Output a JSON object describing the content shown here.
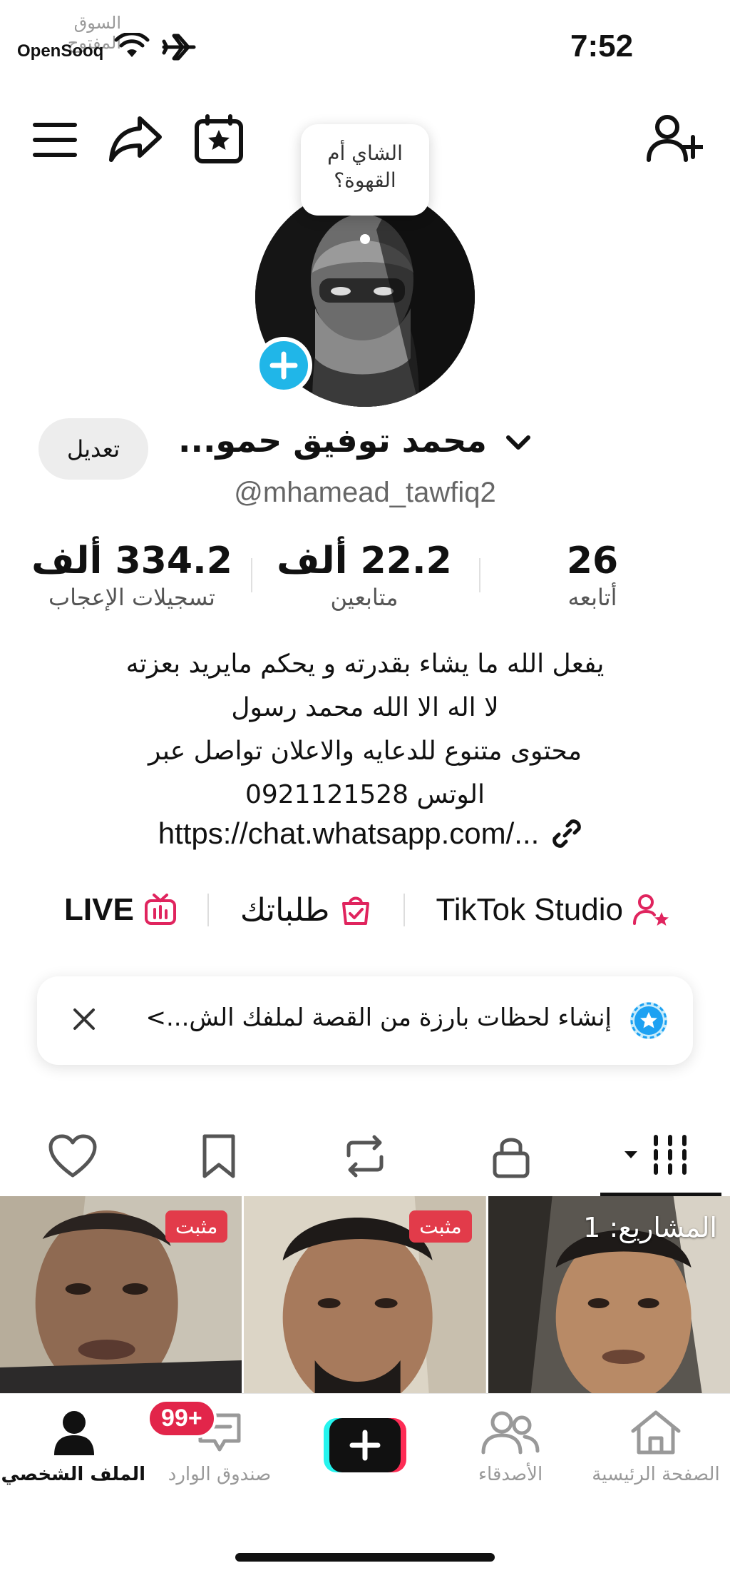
{
  "status_bar": {
    "time": "7:52"
  },
  "watermark": {
    "arabic": "السوق المفتوح",
    "brand": "OpenSooq"
  },
  "profile": {
    "speech_bubble": "الشاي أم القهوة؟",
    "name": "محمد توفيق حمو...",
    "handle": "@mhamead_tawfiq2",
    "edit_label": "تعديل"
  },
  "stats": {
    "following": {
      "value": "26",
      "label": "أتابعه"
    },
    "followers": {
      "value": "22.2 ألف",
      "label": "متابعين"
    },
    "likes": {
      "value": "334.2 ألف",
      "label": "تسجيلات الإعجاب"
    }
  },
  "bio": {
    "lines": [
      "يفعل الله ما يشاء بقدرته و يحكم مايريد بعزته",
      "لا اله الا الله محمد رسول",
      "محتوى متنوع  للدعايه والاعلان تواصل عبر",
      "الوتس 0921121528"
    ],
    "link": "https://chat.whatsapp.com/..."
  },
  "actions": {
    "studio": "TikTok Studio",
    "orders": "طلباتك",
    "live": "LIVE"
  },
  "banner": {
    "text": "إنشاء لحظات بارزة من القصة لملفك الش...>"
  },
  "videos": [
    {
      "badge": "مثبت"
    },
    {
      "badge": "مثبت"
    },
    {
      "badge": "المشاريع: 1"
    }
  ],
  "bottom_nav": {
    "home": "الصفحة الرئيسية",
    "friends": "الأصدقاء",
    "inbox": "صندوق الوارد",
    "inbox_badge": "99+",
    "profile": "الملف الشخصي"
  },
  "colors": {
    "accent_red": "#e23b4a",
    "avatar_plus": "#20b6e8",
    "tiktok_cyan": "#25f4ee",
    "tiktok_pink": "#fe2c55",
    "icon_pink": "#e0245e"
  }
}
